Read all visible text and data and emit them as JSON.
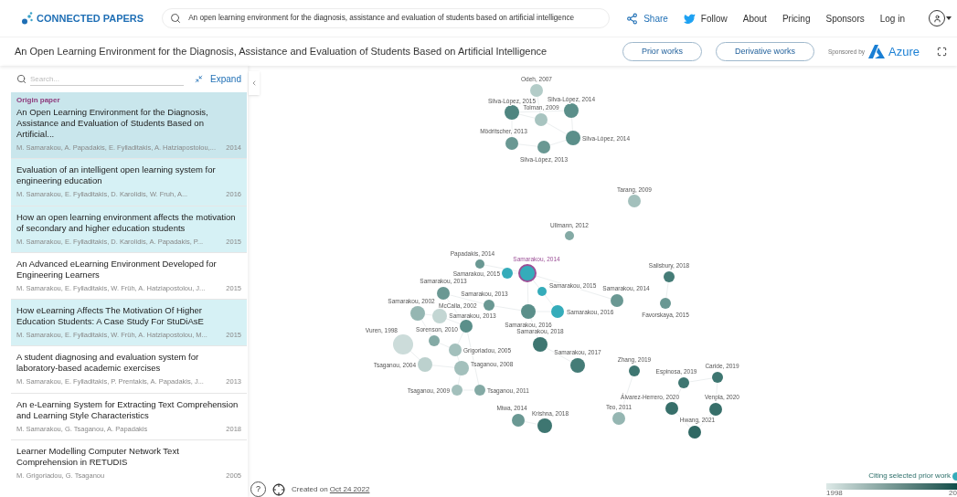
{
  "header": {
    "logo": "CONNECTED PAPERS",
    "search": {
      "value": "An open learning environment for the diagnosis, assistance and evaluation of students based on artificial intelligence"
    },
    "nav": [
      {
        "kind": "share",
        "label": "Share"
      },
      {
        "kind": "follow",
        "label": "Follow"
      },
      {
        "kind": "plain",
        "label": "About"
      },
      {
        "kind": "plain",
        "label": "Pricing"
      },
      {
        "kind": "plain",
        "label": "Sponsors"
      },
      {
        "kind": "plain",
        "label": "Log in"
      }
    ]
  },
  "titlebar": {
    "title": "An Open Learning Environment for the Diagnosis, Assistance and Evaluation of Students Based on Artificial Intelligence",
    "buttons": [
      "Prior works",
      "Derivative works"
    ],
    "sponsored": "Sponsored by",
    "sponsor": "Azure"
  },
  "sidebar": {
    "search": {
      "placeholder": "Search..."
    },
    "expand": "Expand",
    "origin_label": "Origin paper",
    "papers": [
      {
        "kind": "origin",
        "highlighted": true,
        "title": "An Open Learning Environment for the Diagnosis, Assistance and Evaluation of Students Based on Artificial...",
        "authors": "M. Samarakou, A. Papadakis, E. Fylladitakis, A. Hatziapostolou,...",
        "year": "2014"
      },
      {
        "kind": "paper",
        "highlighted": true,
        "title": "Evaluation of an intelligent open learning system for engineering education",
        "authors": "M. Samarakou, E. Fylladitakis, D. Karolidis, W. Fruh, A...",
        "year": "2016"
      },
      {
        "kind": "paper",
        "highlighted": true,
        "title": "How an open learning environment affects the motivation of secondary and higher education students",
        "authors": "M. Samarakou, E. Fylladitakis, D. Karolidis, A. Papadakis, P...",
        "year": "2015"
      },
      {
        "kind": "paper",
        "highlighted": false,
        "title": "An Advanced eLearning Environment Developed for Engineering Learners",
        "authors": "M. Samarakou, E. Fylladitakis, W. Früh, A. Hatziapostolou, J...",
        "year": "2015"
      },
      {
        "kind": "paper",
        "highlighted": true,
        "title": "How eLearning Affects The Motivation Of Higher Education Students: A Case Study For StuDiAsE",
        "authors": "M. Samarakou, E. Fylladitakis, W. Früh, A. Hatziapostolou, M...",
        "year": "2015"
      },
      {
        "kind": "paper",
        "highlighted": false,
        "title": "A student diagnosing and evaluation system for laboratory-based academic exercises",
        "authors": "M. Samarakou, E. Fylladitakis, P. Prentakis, A. Papadakis, J...",
        "year": "2013"
      },
      {
        "kind": "paper",
        "highlighted": false,
        "title": "An e-Learning System for Extracting Text Comprehension and Learning Style Characteristics",
        "authors": "M. Samarakou, G. Tsaganou, A. Papadakis",
        "year": "2018"
      },
      {
        "kind": "paper",
        "highlighted": false,
        "title": "Learner Modelling Computer Network Text Comprehension in RETUDIS",
        "authors": "M. Grigoriadou, G. Tsaganou",
        "year": "2005"
      }
    ]
  },
  "graph": {
    "nodes": [
      {
        "label": "Odeh, 2007",
        "color": "#b3ccc8",
        "kind": "normal"
      },
      {
        "label": "Silva-López, 2015",
        "color": "#4f8580",
        "kind": "normal"
      },
      {
        "label": "Silva-López, 2014",
        "color": "#5b8f8a",
        "kind": "normal"
      },
      {
        "label": "Tolman, 2009",
        "color": "#a8c4c0",
        "kind": "normal"
      },
      {
        "label": "Silva-López, 2014",
        "color": "#5b8f8a",
        "kind": "normal"
      },
      {
        "label": "Mödritscher, 2013",
        "color": "#6a9893",
        "kind": "normal"
      },
      {
        "label": "Silva-López, 2013",
        "color": "#6a9893",
        "kind": "normal"
      },
      {
        "label": "Tarang, 2009",
        "color": "#a3c0bc",
        "kind": "normal"
      },
      {
        "label": "Ullmann, 2012",
        "color": "#84aaa5",
        "kind": "normal"
      },
      {
        "label": "Papadakis, 2014",
        "color": "#6a9893",
        "kind": "normal"
      },
      {
        "label": "Samarakou, 2015",
        "color": "#35acba",
        "kind": "normal"
      },
      {
        "label": "Samarakou, 2014",
        "color": "#35acba",
        "kind": "origin"
      },
      {
        "label": "Samarakou, 2015",
        "color": "#35acba",
        "kind": "normal"
      },
      {
        "label": "Samarakou, 2016",
        "color": "#35acba",
        "kind": "normal"
      },
      {
        "label": "Samarakou, 2014",
        "color": "#6a9893",
        "kind": "normal"
      },
      {
        "label": "Samarakou, 2013",
        "color": "#6a9893",
        "kind": "normal"
      },
      {
        "label": "Samarakou, 2013",
        "color": "#6a9893",
        "kind": "normal"
      },
      {
        "label": "Samarakou, 2016",
        "color": "#5b8f8a",
        "kind": "normal"
      },
      {
        "label": "Samarakou, 2002",
        "color": "#95b6b2",
        "kind": "normal"
      },
      {
        "label": "McCalla, 2002",
        "color": "#c3d6d3",
        "kind": "normal"
      },
      {
        "label": "Samarakou, 2013",
        "color": "#5b8f8a",
        "kind": "normal"
      },
      {
        "label": "Sorenson, 2010",
        "color": "#84aaa5",
        "kind": "normal"
      },
      {
        "label": "Grigoriadou, 2005",
        "color": "#a3c0bc",
        "kind": "normal"
      },
      {
        "label": "Vuren, 1998",
        "color": "#ccdcda",
        "kind": "normal"
      },
      {
        "label": "Tsaganou, 2004",
        "color": "#bcd1ce",
        "kind": "normal"
      },
      {
        "label": "Tsaganou, 2008",
        "color": "#a3c0bc",
        "kind": "normal"
      },
      {
        "label": "Tsaganou, 2009",
        "color": "#a3c0bc",
        "kind": "normal"
      },
      {
        "label": "Tsaganou, 2011",
        "color": "#84aaa5",
        "kind": "normal"
      },
      {
        "label": "Samarakou, 2018",
        "color": "#3e7671",
        "kind": "normal"
      },
      {
        "label": "Samarakou, 2017",
        "color": "#457c77",
        "kind": "normal"
      },
      {
        "label": "Zhang, 2019",
        "color": "#3e7671",
        "kind": "normal"
      },
      {
        "label": "Espinosa, 2019",
        "color": "#3e7671",
        "kind": "normal"
      },
      {
        "label": "Caride, 2019",
        "color": "#3e7671",
        "kind": "normal"
      },
      {
        "label": "Álvarez-Herrero, 2020",
        "color": "#376f6a",
        "kind": "normal"
      },
      {
        "label": "Venpla, 2020",
        "color": "#376f6a",
        "kind": "normal"
      },
      {
        "label": "Hwang, 2021",
        "color": "#2f6863",
        "kind": "normal"
      },
      {
        "label": "Teo, 2011",
        "color": "#95b6b2",
        "kind": "normal"
      },
      {
        "label": "Miwa, 2014",
        "color": "#6a9893",
        "kind": "normal"
      },
      {
        "label": "Krishna, 2018",
        "color": "#3e7671",
        "kind": "normal"
      },
      {
        "label": "Salisbury, 2018",
        "color": "#457c77",
        "kind": "normal"
      },
      {
        "label": "Favorskaya, 2015",
        "color": "#6a9893",
        "kind": "normal"
      }
    ]
  },
  "footer": {
    "help": "?",
    "created": "Created on",
    "date": "Oct 24 2022"
  },
  "legend": {
    "label": "Citing selected prior work",
    "start": "1998",
    "end": "20"
  }
}
